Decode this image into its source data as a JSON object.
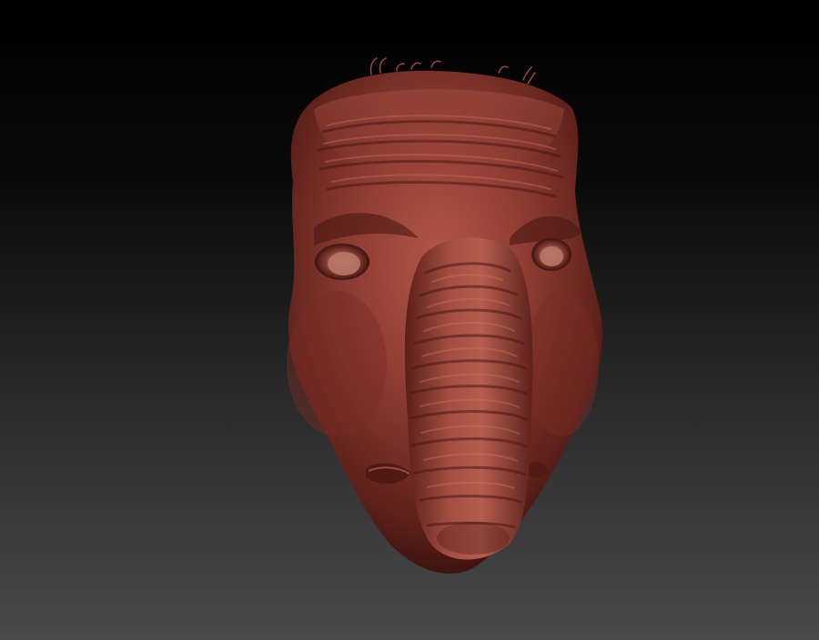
{
  "viewport": {
    "background_top": "#000000",
    "background_bottom": "#4a4a4a"
  },
  "model": {
    "name": "",
    "material_color": "#8a3a30",
    "material_shadow": "#4a1712",
    "material_highlight": "#c26a58"
  }
}
